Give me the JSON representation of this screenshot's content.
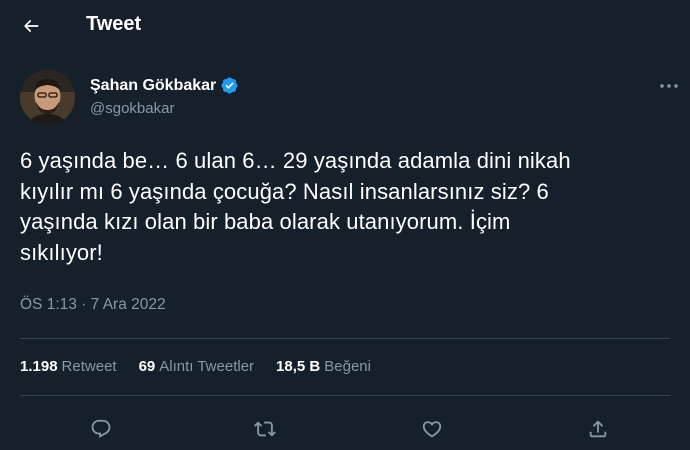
{
  "header": {
    "title": "Tweet"
  },
  "author": {
    "name": "Şahan Gökbakar",
    "handle": "@sgokbakar"
  },
  "tweet": {
    "lines": [
      "6 yaşında be… 6 ulan 6… 29 yaşında adamla dini nikah",
      "kıyılır mı 6 yaşında çocuğa? Nasıl insanlarsınız siz? 6",
      "yaşında kızı olan bir baba olarak utanıyorum. İçim",
      "sıkılıyor!"
    ],
    "timestamp": "ÖS 1:13 · 7 Ara 2022"
  },
  "stats": [
    {
      "count": "1.198",
      "label": "Retweet"
    },
    {
      "count": "69",
      "label": "Alıntı Tweetler"
    },
    {
      "count": "18,5 B",
      "label": "Beğeni"
    }
  ],
  "colors": {
    "background": "#15202b",
    "muted": "#8899a6",
    "divider": "#38444d",
    "verified": "#1d9bf0"
  },
  "icons": {
    "back": "arrow-left-icon",
    "verified": "verified-badge-icon",
    "more": "more-horizontal-icon",
    "reply": "reply-icon",
    "retweet": "retweet-icon",
    "like": "heart-icon",
    "share": "share-icon"
  }
}
